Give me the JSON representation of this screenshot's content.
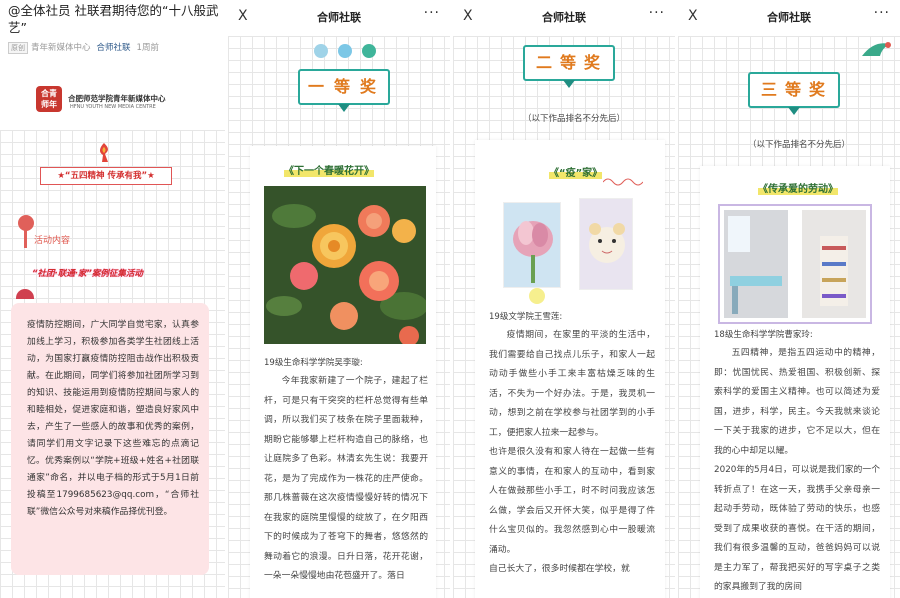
{
  "article": {
    "title": "@全体社员 社联君期待您的“十八般武艺”",
    "tag": "原创",
    "author": "青年新媒体中心",
    "account": "合师社联",
    "time": "1周前"
  },
  "org": {
    "logo_text": "合青\n师年",
    "name": "合肥师范学院青年新媒体中心",
    "name_en": "HFNU YOUTH NEW MEDIA CENTRE"
  },
  "intro": {
    "banner": "★“五四精神 传承有我”★",
    "section": "活动内容",
    "subtitle": "“社团·联通·家”案例征集活动",
    "body": "疫情防控期间，广大同学自觉宅家，认真参加线上学习，积极参加各类学生社团线上活动，为国家打赢疫情防控阻击战作出积极贡献。在此期间，同学们将参加社团所学习到的知识、技能运用到疫情防控期间与家人的和睦相处，促进家庭和谐，塑造良好家风中去，产生了一些感人的故事和优秀的案例，请同学们用文字记录下这些难忘的点滴记忆。优秀案例以“学院+班级+姓名+社团联通家”命名，并以电子档的形式于5月1日前投稿至1799685623@qq.com，“合师社联”微信公众号对来稿作品择优刊登。"
  },
  "nav": {
    "close": "X",
    "title": "合师社联",
    "more": "···"
  },
  "first": {
    "award": "一等奖",
    "work_title": "《下一个春暖花开》",
    "author": "19级生命科学学院吴李璇:",
    "text": "今年我家新建了一个院子，建起了栏杆，可是只有干突突的栏杆总觉得有些单调，所以我们买了枝条在院子里面栽种，期盼它能够攀上栏杆构造自己的脉络，也让庭院多了色彩。林清玄先生说：我要开花，是为了完成作为一株花的庄严使命。那几株蔷薇在这次疫情慢慢好转的情况下在我家的庭院里慢慢的绽放了，在夕阳西下的时候成为了苍穹下的舞者，悠悠然的舞动着它的浪漫。日升日落，花开花谢，一朵一朵慢慢地由花苞盛开了。落日"
  },
  "second": {
    "award": "二等奖",
    "note": "（以下作品排名不分先后）",
    "work_title": "《“疫”家》",
    "author": "19级文学院王雪莲:",
    "text": "疫情期间，在家里的平淡的生活中，我们需要给自己找点儿乐子，和家人一起动动手做些小手工来丰富枯燥乏味的生活，不失为一个好办法。于是，我灵机一动，想到之前在学校参与社团学到的小手工，便把家人拉来一起参与。\n也许是很久没有和家人待在一起做一些有意义的事情，在和家人的互动中，看到家人在做鼓那些小手工，时不时问我应该怎么做，学会后又开怀大笑，似乎是得了件什么宝贝似的。我忽然感到心中一股暖流涌动。\n自己长大了，很多时候都在学校，就"
  },
  "third": {
    "award": "三等奖",
    "note": "（以下作品排名不分先后）",
    "work_title": "《传承爱的劳动》",
    "author": "18级生命科学学院曹家玲:",
    "text": "五四精神，是指五四运动中的精神，即：忧国忧民、热爱祖国、积极创新、探索科学的爱国主义精神。也可以简述为爱国，进步，科学，民主。今天我就来谈论一下关于我家的进步，它不足以大，但在我的心中却足以耀。\n2020年的5月4日，可以说是我们家的一个转折点了！在这一天，我携手父亲母亲一起动手劳动，既体验了劳动的快乐，也感受到了成果收获的喜悦。在干活的期间，我们有很多温馨的互动，爸爸妈妈可以说是主力军了，帮我把买好的写字桌子之类的家具搬到了我的房间"
  },
  "colors": {
    "accent_teal": "#2aa89a",
    "award_orange": "#e07a1e",
    "title_green": "#2d6f34",
    "card_pink": "#fde4e6",
    "red": "#d32f2f"
  }
}
